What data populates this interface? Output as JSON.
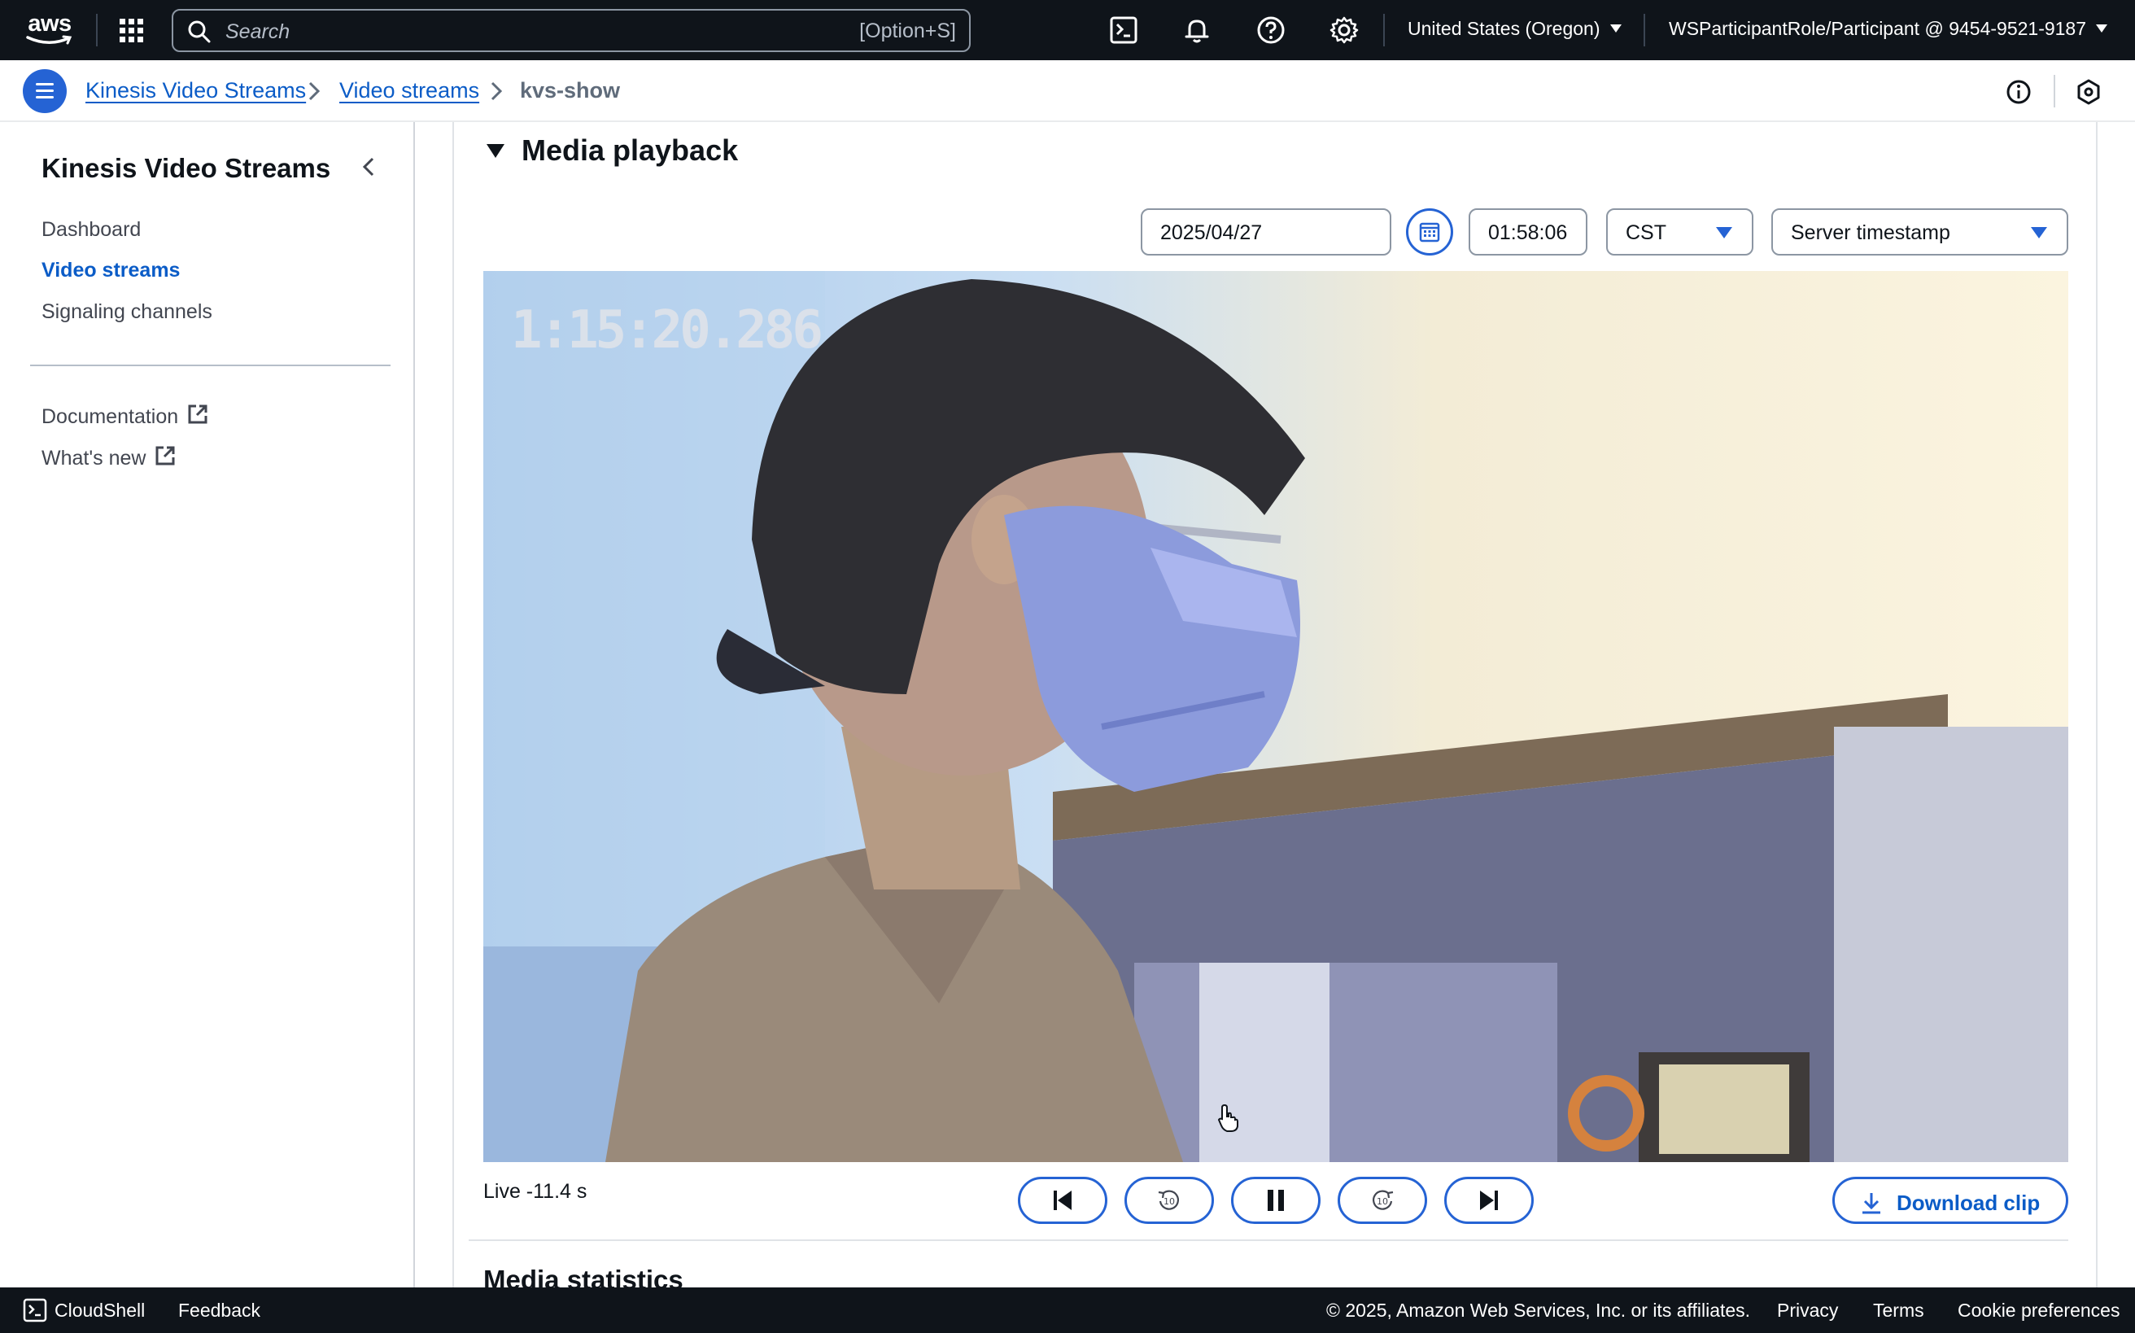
{
  "topnav": {
    "logo_text": "aws",
    "search_placeholder": "Search",
    "search_shortcut": "[Option+S]",
    "region": "United States (Oregon)",
    "account": "WSParticipantRole/Participant @ 9454-9521-9187"
  },
  "breadcrumbs": [
    {
      "label": "Kinesis Video Streams"
    },
    {
      "label": "Video streams"
    },
    {
      "label": "kvs-show"
    }
  ],
  "sidenav": {
    "title": "Kinesis Video Streams",
    "items": [
      {
        "label": "Dashboard",
        "active": false
      },
      {
        "label": "Video streams",
        "active": true
      },
      {
        "label": "Signaling channels",
        "active": false
      }
    ],
    "links": [
      {
        "label": "Documentation"
      },
      {
        "label": "What's new"
      }
    ]
  },
  "media_playback": {
    "title": "Media playback",
    "date": "2025/04/27",
    "time": "01:58:06",
    "timezone": "CST",
    "timestamp_type": "Server timestamp",
    "video_overlay_time": "1:15:20.286",
    "live_status": "Live -11.4 s",
    "download_label": "Download clip"
  },
  "media_statistics": {
    "title": "Media statistics"
  },
  "footer": {
    "cloudshell": "CloudShell",
    "feedback": "Feedback",
    "copyright": "© 2025, Amazon Web Services, Inc. or its affiliates.",
    "privacy": "Privacy",
    "terms": "Terms",
    "cookie": "Cookie preferences"
  },
  "colors": {
    "nav_bg": "#0f141a",
    "link_blue": "#0b5cc7",
    "accent_blue": "#2563d4"
  }
}
